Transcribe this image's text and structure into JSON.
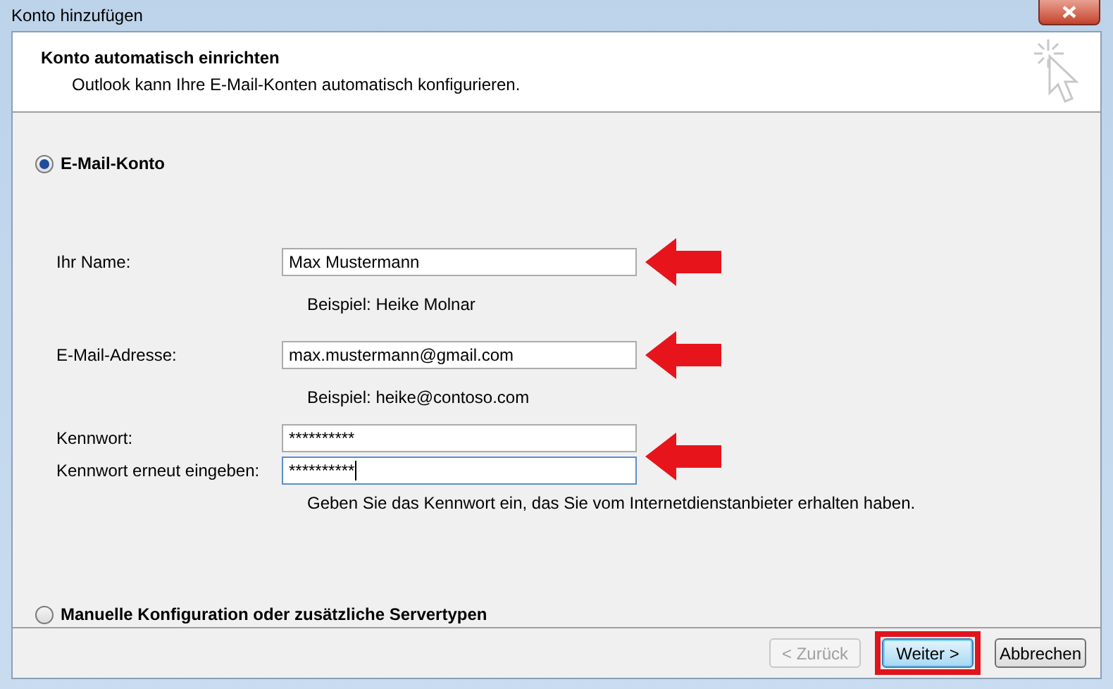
{
  "window": {
    "title": "Konto hinzufügen"
  },
  "header": {
    "title": "Konto automatisch einrichten",
    "subtitle": "Outlook kann Ihre E-Mail-Konten automatisch konfigurieren."
  },
  "options": [
    {
      "label": "E-Mail-Konto",
      "selected": true
    },
    {
      "label": "Manuelle Konfiguration oder zusätzliche Servertypen",
      "selected": false
    }
  ],
  "groups": [
    {
      "annotated": true,
      "example": "Beispiel: Heike Molnar",
      "fields": [
        {
          "label": "Ihr Name:",
          "value": "Max Mustermann",
          "focused": false
        }
      ]
    },
    {
      "annotated": true,
      "example": "Beispiel: heike@contoso.com",
      "fields": [
        {
          "label": "E-Mail-Adresse:",
          "value": "max.mustermann@gmail.com",
          "focused": false
        }
      ]
    },
    {
      "annotated": true,
      "example": "Geben Sie das Kennwort ein, das Sie vom Internetdienstanbieter erhalten haben.",
      "fields": [
        {
          "label": "Kennwort:",
          "value": "**********",
          "focused": false
        },
        {
          "label": "Kennwort erneut eingeben:",
          "value": "**********",
          "focused": true
        }
      ]
    }
  ],
  "buttons": [
    {
      "label": "< Zurück",
      "disabled": true,
      "default": false,
      "annotated": false
    },
    {
      "label": "Weiter >",
      "disabled": false,
      "default": true,
      "annotated": true
    },
    {
      "label": "Abbrechen",
      "disabled": false,
      "default": false,
      "annotated": false
    }
  ]
}
